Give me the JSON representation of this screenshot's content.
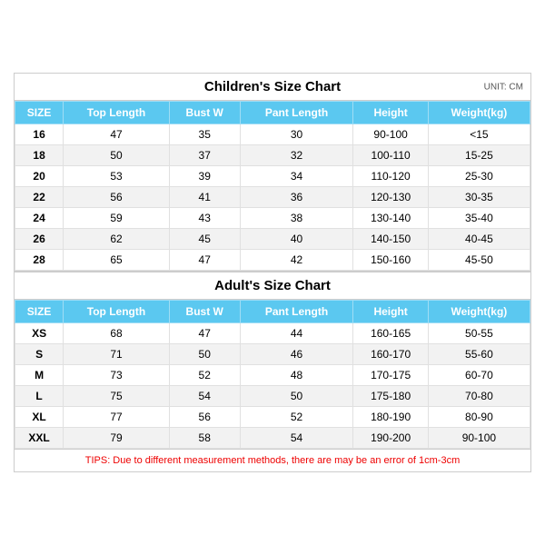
{
  "children_chart": {
    "title": "Children's Size Chart",
    "unit": "UNIT: CM",
    "headers": [
      "SIZE",
      "Top Length",
      "Bust W",
      "Pant Length",
      "Height",
      "Weight(kg)"
    ],
    "rows": [
      [
        "16",
        "47",
        "35",
        "30",
        "90-100",
        "<15"
      ],
      [
        "18",
        "50",
        "37",
        "32",
        "100-110",
        "15-25"
      ],
      [
        "20",
        "53",
        "39",
        "34",
        "110-120",
        "25-30"
      ],
      [
        "22",
        "56",
        "41",
        "36",
        "120-130",
        "30-35"
      ],
      [
        "24",
        "59",
        "43",
        "38",
        "130-140",
        "35-40"
      ],
      [
        "26",
        "62",
        "45",
        "40",
        "140-150",
        "40-45"
      ],
      [
        "28",
        "65",
        "47",
        "42",
        "150-160",
        "45-50"
      ]
    ]
  },
  "adult_chart": {
    "title": "Adult's Size Chart",
    "headers": [
      "SIZE",
      "Top Length",
      "Bust W",
      "Pant Length",
      "Height",
      "Weight(kg)"
    ],
    "rows": [
      [
        "XS",
        "68",
        "47",
        "44",
        "160-165",
        "50-55"
      ],
      [
        "S",
        "71",
        "50",
        "46",
        "160-170",
        "55-60"
      ],
      [
        "M",
        "73",
        "52",
        "48",
        "170-175",
        "60-70"
      ],
      [
        "L",
        "75",
        "54",
        "50",
        "175-180",
        "70-80"
      ],
      [
        "XL",
        "77",
        "56",
        "52",
        "180-190",
        "80-90"
      ],
      [
        "XXL",
        "79",
        "58",
        "54",
        "190-200",
        "90-100"
      ]
    ]
  },
  "tips": "TIPS: Due to different measurement methods, there are may be an error of 1cm-3cm"
}
